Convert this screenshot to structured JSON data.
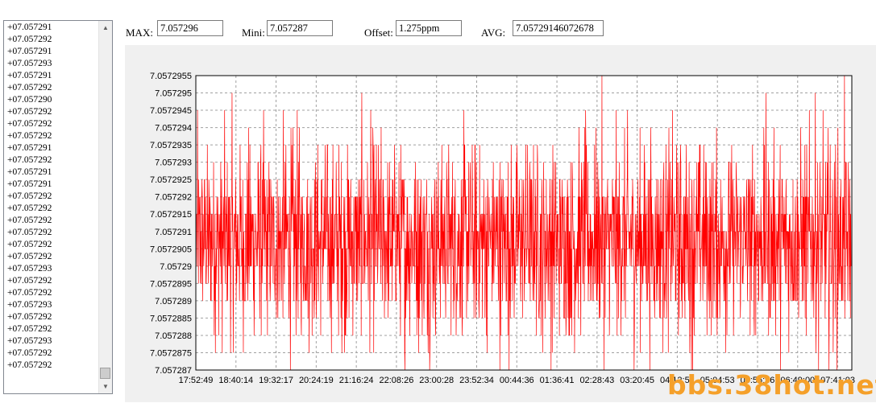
{
  "list": {
    "items": [
      "+07.057291",
      "+07.057292",
      "+07.057291",
      "+07.057293",
      "+07.057291",
      "+07.057292",
      "+07.057290",
      "+07.057292",
      "+07.057292",
      "+07.057292",
      "+07.057291",
      "+07.057292",
      "+07.057291",
      "+07.057291",
      "+07.057292",
      "+07.057292",
      "+07.057292",
      "+07.057292",
      "+07.057292",
      "+07.057292",
      "+07.057293",
      "+07.057292",
      "+07.057292",
      "+07.057293",
      "+07.057292",
      "+07.057292",
      "+07.057293",
      "+07.057292",
      "+07.057292"
    ]
  },
  "fields": {
    "max_label": "MAX:",
    "max_value": "7.057296",
    "mini_label": "Mini:",
    "mini_value": "7.057287",
    "offset_label": "Offset:",
    "offset_value": "1.275ppm",
    "avg_label": "AVG:",
    "avg_value": "7.05729146072678"
  },
  "chart_data": {
    "type": "line",
    "ylim": [
      7.057287,
      7.0572955
    ],
    "y_ticks": [
      "7.0572955",
      "7.057295",
      "7.0572945",
      "7.057294",
      "7.0572935",
      "7.057293",
      "7.0572925",
      "7.057292",
      "7.0572915",
      "7.057291",
      "7.0572905",
      "7.05729",
      "7.0572895",
      "7.057289",
      "7.0572885",
      "7.057288",
      "7.0572875",
      "7.057287"
    ],
    "x_ticks": [
      "17:52:49",
      "18:40:14",
      "19:32:17",
      "20:24:19",
      "21:16:24",
      "22:08:26",
      "23:00:28",
      "23:52:34",
      "00:44:36",
      "01:36:41",
      "02:28:43",
      "03:20:45",
      "04:12:51",
      "05:04:53",
      "05:56:56",
      "06:49:00",
      "07:41:03"
    ],
    "series_color": "#ff0000",
    "grid": true,
    "series": [
      {
        "values": [
          7.057292,
          7.057293,
          7.057291,
          7.057292,
          7.057292,
          7.05729,
          7.057292,
          7.057292,
          7.057291,
          7.057293,
          7.057292,
          7.057291,
          7.057292,
          7.057292,
          7.05729,
          7.057292,
          7.057292,
          7.057291,
          7.057293,
          7.057292,
          7.057292,
          7.057291,
          7.057292,
          7.057292,
          7.057293,
          7.057292,
          7.057291,
          7.057292,
          7.057292,
          7.05729,
          7.057292,
          7.057292,
          7.057291,
          7.057293,
          7.057292,
          7.057292,
          7.057291,
          7.057292,
          7.057292,
          7.057292,
          7.057291,
          7.057293,
          7.057292,
          7.057291,
          7.057292,
          7.057292,
          7.05729,
          7.057292,
          7.057293,
          7.057292
        ]
      }
    ]
  },
  "watermark": "bbs.38hot.net"
}
